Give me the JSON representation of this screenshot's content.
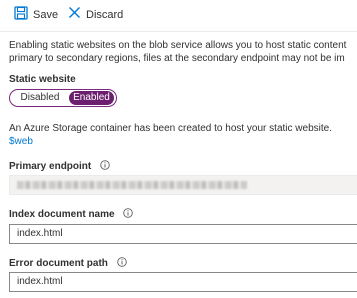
{
  "toolbar": {
    "save_label": "Save",
    "discard_label": "Discard"
  },
  "description": {
    "line1": "Enabling static websites on the blob service allows you to host static content",
    "line2": "primary to secondary regions, files at the secondary endpoint may not be im"
  },
  "static_website": {
    "label": "Static website",
    "options": [
      "Disabled",
      "Enabled"
    ],
    "selected": "Enabled"
  },
  "container_note": "An Azure Storage container has been created to host your static website.",
  "container_link": "$web",
  "primary_endpoint": {
    "label": "Primary endpoint",
    "value_obscured": true
  },
  "index_document": {
    "label": "Index document name",
    "value": "index.html"
  },
  "error_document": {
    "label": "Error document path",
    "value": "index.html"
  },
  "icons": {
    "save": "save-icon",
    "discard": "close-icon",
    "info": "info-icon"
  },
  "colors": {
    "accent": "#6b1f6e",
    "link": "#0078d4",
    "toolbar_icon": "#0078d4"
  }
}
